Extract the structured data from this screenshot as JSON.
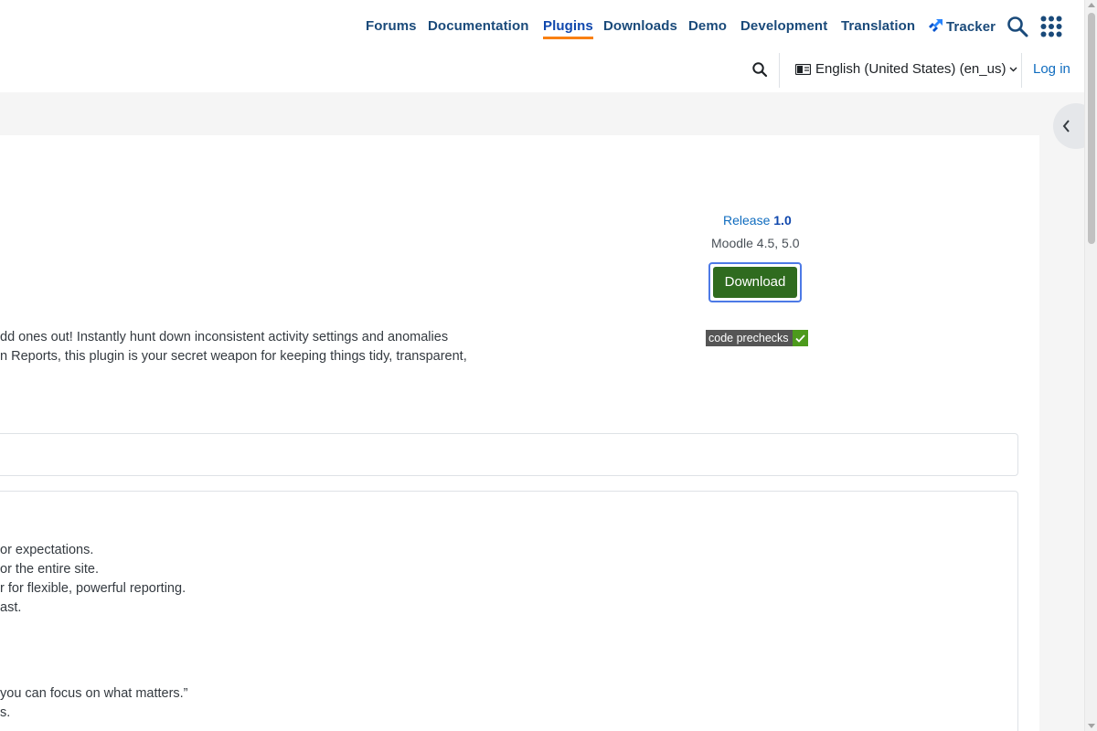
{
  "nav": {
    "items": [
      {
        "label": "Forums",
        "active": false
      },
      {
        "label": "Documentation",
        "active": false
      },
      {
        "label": "Plugins",
        "active": true
      },
      {
        "label": "Downloads",
        "active": false
      },
      {
        "label": "Demo",
        "active": false
      },
      {
        "label": "Development",
        "active": false
      },
      {
        "label": "Translation",
        "active": false
      },
      {
        "label": "Tracker",
        "active": false,
        "icon": "tracker-icon"
      }
    ],
    "search_icon": "search-icon",
    "apps_icon": "apps-grid-icon"
  },
  "secondary": {
    "search_icon": "search-icon",
    "language": "English (United States) (en_us)",
    "language_icon": "language-icon",
    "login": "Log in"
  },
  "release": {
    "prefix": "Release",
    "version": "1.0",
    "moodle_versions": "Moodle 4.5, 5.0",
    "download_label": "Download",
    "badge_label": "code prechecks",
    "badge_status": "passed"
  },
  "description": {
    "line1": "dd ones out! Instantly hunt down inconsistent activity settings and anomalies",
    "line2": "n Reports, this plugin is your secret weapon for keeping things tidy, transparent,"
  },
  "features": {
    "line1": "or expectations.",
    "line2": "or the entire site.",
    "line3": "r for flexible, powerful reporting.",
    "line4": "ast."
  },
  "quote": {
    "line1": "you can focus on what matters.”",
    "line2": "s."
  },
  "colors": {
    "nav_text": "#1a4a7a",
    "active_underline": "#f98012",
    "link": "#0f6cbf",
    "download_button": "#2f6b1f",
    "badge_ok": "#4c9a1c",
    "page_bg": "#f5f5f5"
  }
}
